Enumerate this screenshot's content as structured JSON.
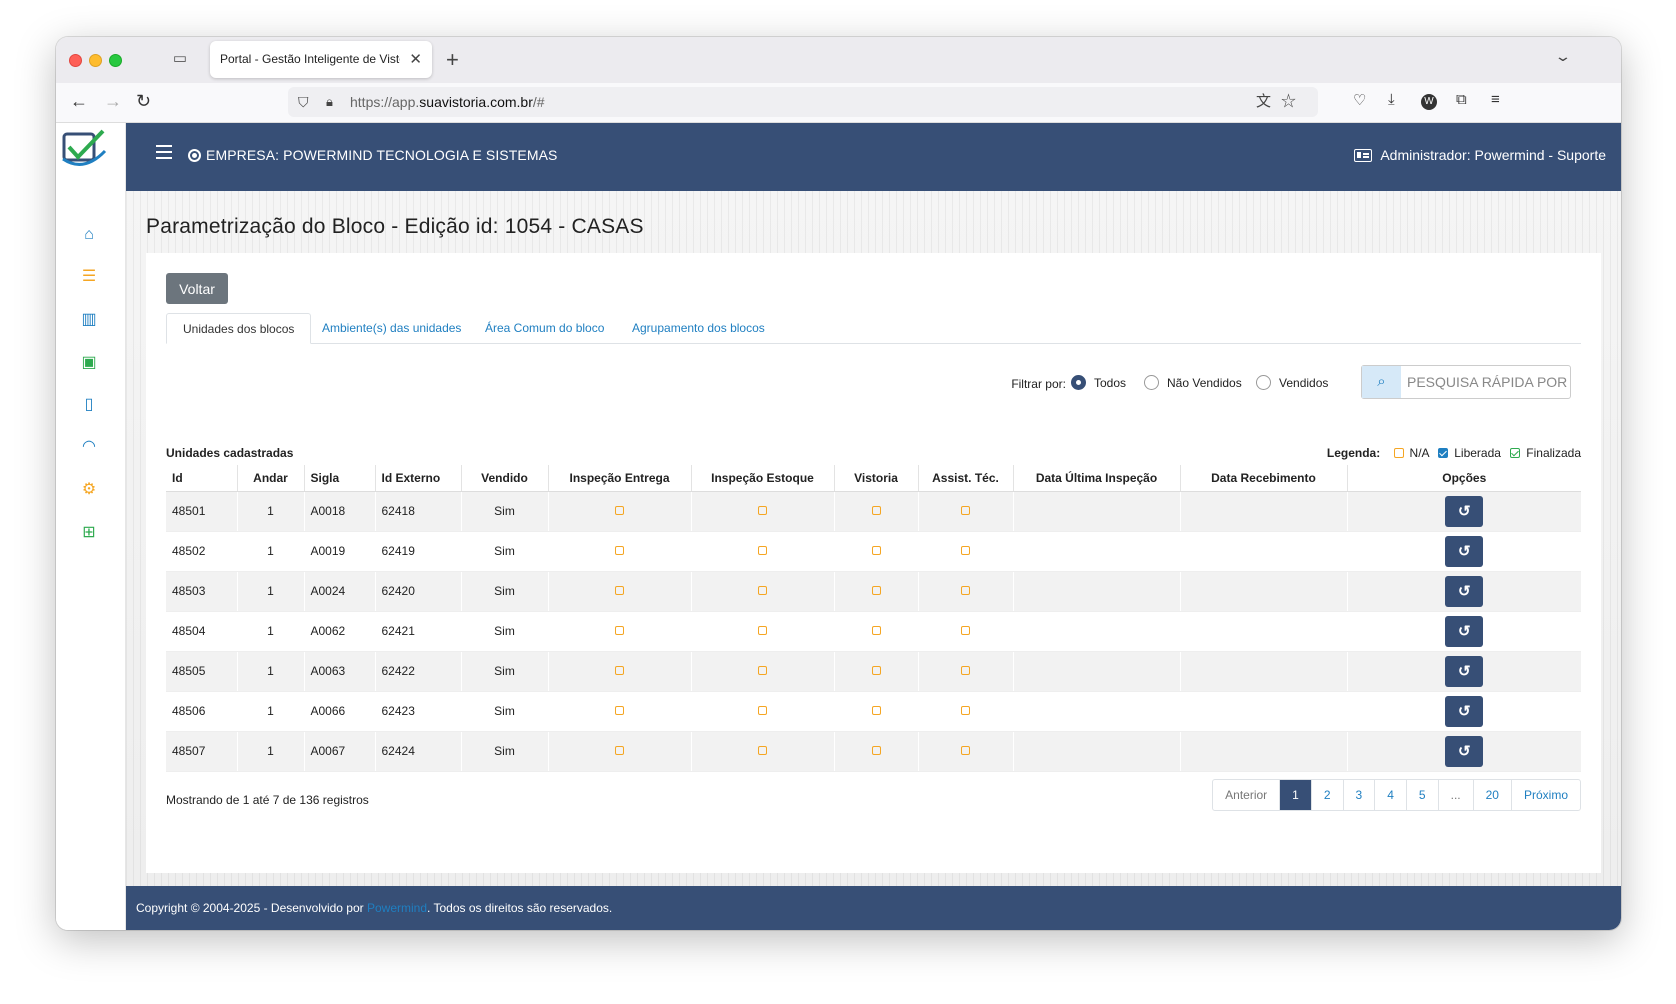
{
  "browser": {
    "tab_title": "Portal - Gestão Inteligente de Vistorias",
    "url_prefix": "https://app.",
    "url_domain": "suavistoria.com.br",
    "url_suffix": "/#"
  },
  "topbar": {
    "company": "EMPRESA: POWERMIND TECNOLOGIA E SISTEMAS",
    "admin": "Administrador: Powermind - Suporte"
  },
  "page": {
    "title": "Parametrização do Bloco - Edição id: 1054 - CASAS",
    "back_label": "Voltar"
  },
  "tabs": [
    {
      "label": "Unidades dos blocos"
    },
    {
      "label": "Ambiente(s) das unidades"
    },
    {
      "label": "Área Comum do bloco"
    },
    {
      "label": "Agrupamento dos blocos"
    }
  ],
  "filter": {
    "label": "Filtrar por:",
    "options": [
      "Todos",
      "Não Vendidos",
      "Vendidos"
    ],
    "selected": "Todos",
    "search_placeholder": "PESQUISA RÁPIDA POR"
  },
  "units": {
    "title": "Unidades cadastradas",
    "legend_label": "Legenda:",
    "legend": [
      "N/A",
      "Liberada",
      "Finalizada"
    ],
    "columns": [
      "Id",
      "Andar",
      "Sigla",
      "Id Externo",
      "Vendido",
      "Inspeção Entrega",
      "Inspeção Estoque",
      "Vistoria",
      "Assist. Téc.",
      "Data Última Inspeção",
      "Data Recebimento",
      "Opções"
    ],
    "rows": [
      {
        "id": "48501",
        "andar": "1",
        "sigla": "A0018",
        "id_externo": "62418",
        "vendido": "Sim"
      },
      {
        "id": "48502",
        "andar": "1",
        "sigla": "A0019",
        "id_externo": "62419",
        "vendido": "Sim"
      },
      {
        "id": "48503",
        "andar": "1",
        "sigla": "A0024",
        "id_externo": "62420",
        "vendido": "Sim"
      },
      {
        "id": "48504",
        "andar": "1",
        "sigla": "A0062",
        "id_externo": "62421",
        "vendido": "Sim"
      },
      {
        "id": "48505",
        "andar": "1",
        "sigla": "A0063",
        "id_externo": "62422",
        "vendido": "Sim"
      },
      {
        "id": "48506",
        "andar": "1",
        "sigla": "A0066",
        "id_externo": "62423",
        "vendido": "Sim"
      },
      {
        "id": "48507",
        "andar": "1",
        "sigla": "A0067",
        "id_externo": "62424",
        "vendido": "Sim"
      }
    ],
    "showing": "Mostrando de 1 até 7 de 136 registros"
  },
  "pagination": {
    "prev": "Anterior",
    "pages": [
      "1",
      "2",
      "3",
      "4",
      "5",
      "...",
      "20"
    ],
    "next": "Próximo",
    "active": "1"
  },
  "footer": {
    "prefix": "Copyright © 2004-2025 - Desenvolvido por ",
    "brand": "Powermind",
    "suffix": ". Todos os direitos são reservados."
  },
  "colors": {
    "primary": "#374f76",
    "link": "#1f7fc1",
    "na": "#f5a623",
    "finalizada": "#2eaa4f"
  }
}
